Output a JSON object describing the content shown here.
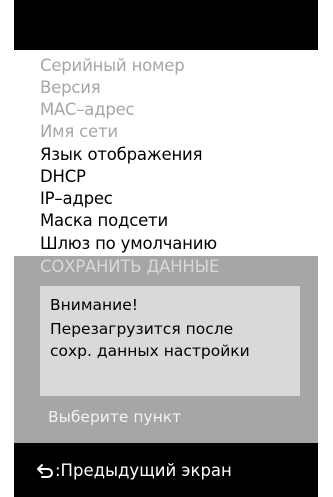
{
  "menu": {
    "items": [
      {
        "label": "Серийный номер",
        "enabled": false
      },
      {
        "label": "Версия",
        "enabled": false
      },
      {
        "label": "MAC–адрес",
        "enabled": false
      },
      {
        "label": "Имя сети",
        "enabled": false
      },
      {
        "label": "Язык отображения",
        "enabled": true
      },
      {
        "label": "DHCP",
        "enabled": true
      },
      {
        "label": "IP–адрес",
        "enabled": true
      },
      {
        "label": "Маска подсети",
        "enabled": true
      },
      {
        "label": "Шлюз по умолчанию",
        "enabled": true
      }
    ],
    "save": {
      "label": "СОХРАНИТЬ ДАННЫЕ",
      "selected": true
    }
  },
  "notice": {
    "line1": "Внимание!",
    "line2": "Перезагрузится после",
    "line3": "сохр. данных настройки"
  },
  "prompt": "Выберите пункт",
  "footer": {
    "back_icon": "return-arrow-icon",
    "back_label": ":Предыдущий экран"
  },
  "colors": {
    "background": "#000000",
    "menu_background": "#ffffff",
    "disabled_text": "#a6a6a6",
    "selected_row": "#a6a6a6",
    "notice_background": "#d9d9d9"
  }
}
